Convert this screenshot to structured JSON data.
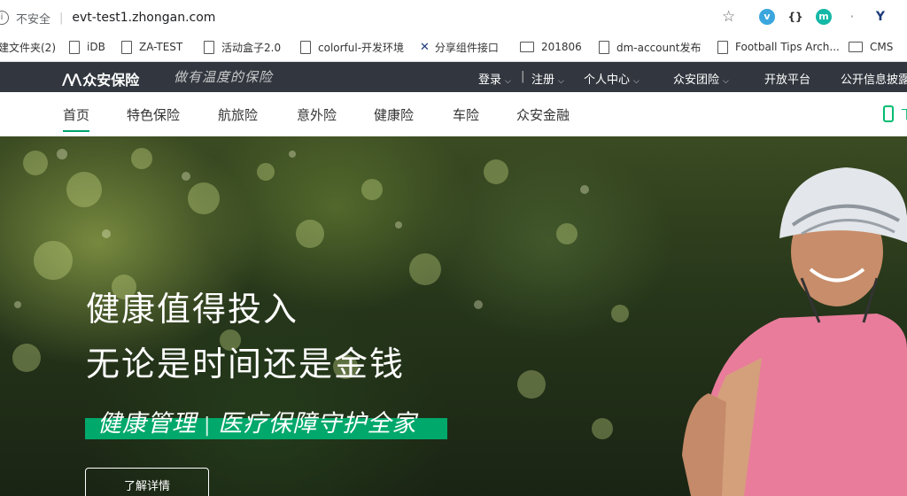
{
  "browser": {
    "security": "不安全",
    "url": "evt-test1.zhongan.com",
    "extensions": [
      "v",
      "{}",
      "m",
      "·",
      "Y"
    ],
    "bookmarks": [
      {
        "label": "建文件夹(2)",
        "icon": "none"
      },
      {
        "label": "iDB",
        "icon": "doc-icon"
      },
      {
        "label": "ZA-TEST",
        "icon": "doc-icon"
      },
      {
        "label": "活动盒子2.0",
        "icon": "doc-icon"
      },
      {
        "label": "colorful-开发环境",
        "icon": "doc-icon"
      },
      {
        "label": "分享组件接口",
        "icon": "x-icon"
      },
      {
        "label": "201806",
        "icon": "folder-icon"
      },
      {
        "label": "dm-account发布",
        "icon": "doc-icon"
      },
      {
        "label": "Football Tips Arch...",
        "icon": "doc-icon"
      },
      {
        "label": "CMS",
        "icon": "folder-icon"
      }
    ]
  },
  "site": {
    "logo_text": "众安保险",
    "slogan": "做有温度的保险",
    "topnav": {
      "login": "登录",
      "divider": "|",
      "register": "注册",
      "personal": "个人中心",
      "group": "众安团险",
      "open": "开放平台",
      "disclosure": "公开信息披露"
    },
    "mainnav": [
      "首页",
      "特色保险",
      "航旅险",
      "意外险",
      "健康险",
      "车险",
      "众安金融"
    ],
    "app_label": "下"
  },
  "hero": {
    "line1": "健康值得投入",
    "line2": "无论是时间还是金钱",
    "tag_left": "健康管理",
    "tag_bar": "|",
    "tag_right": "医疗保障守护全家",
    "button": "了解详情"
  },
  "colors": {
    "topbar": "#32373f",
    "accent": "#00a86b"
  }
}
